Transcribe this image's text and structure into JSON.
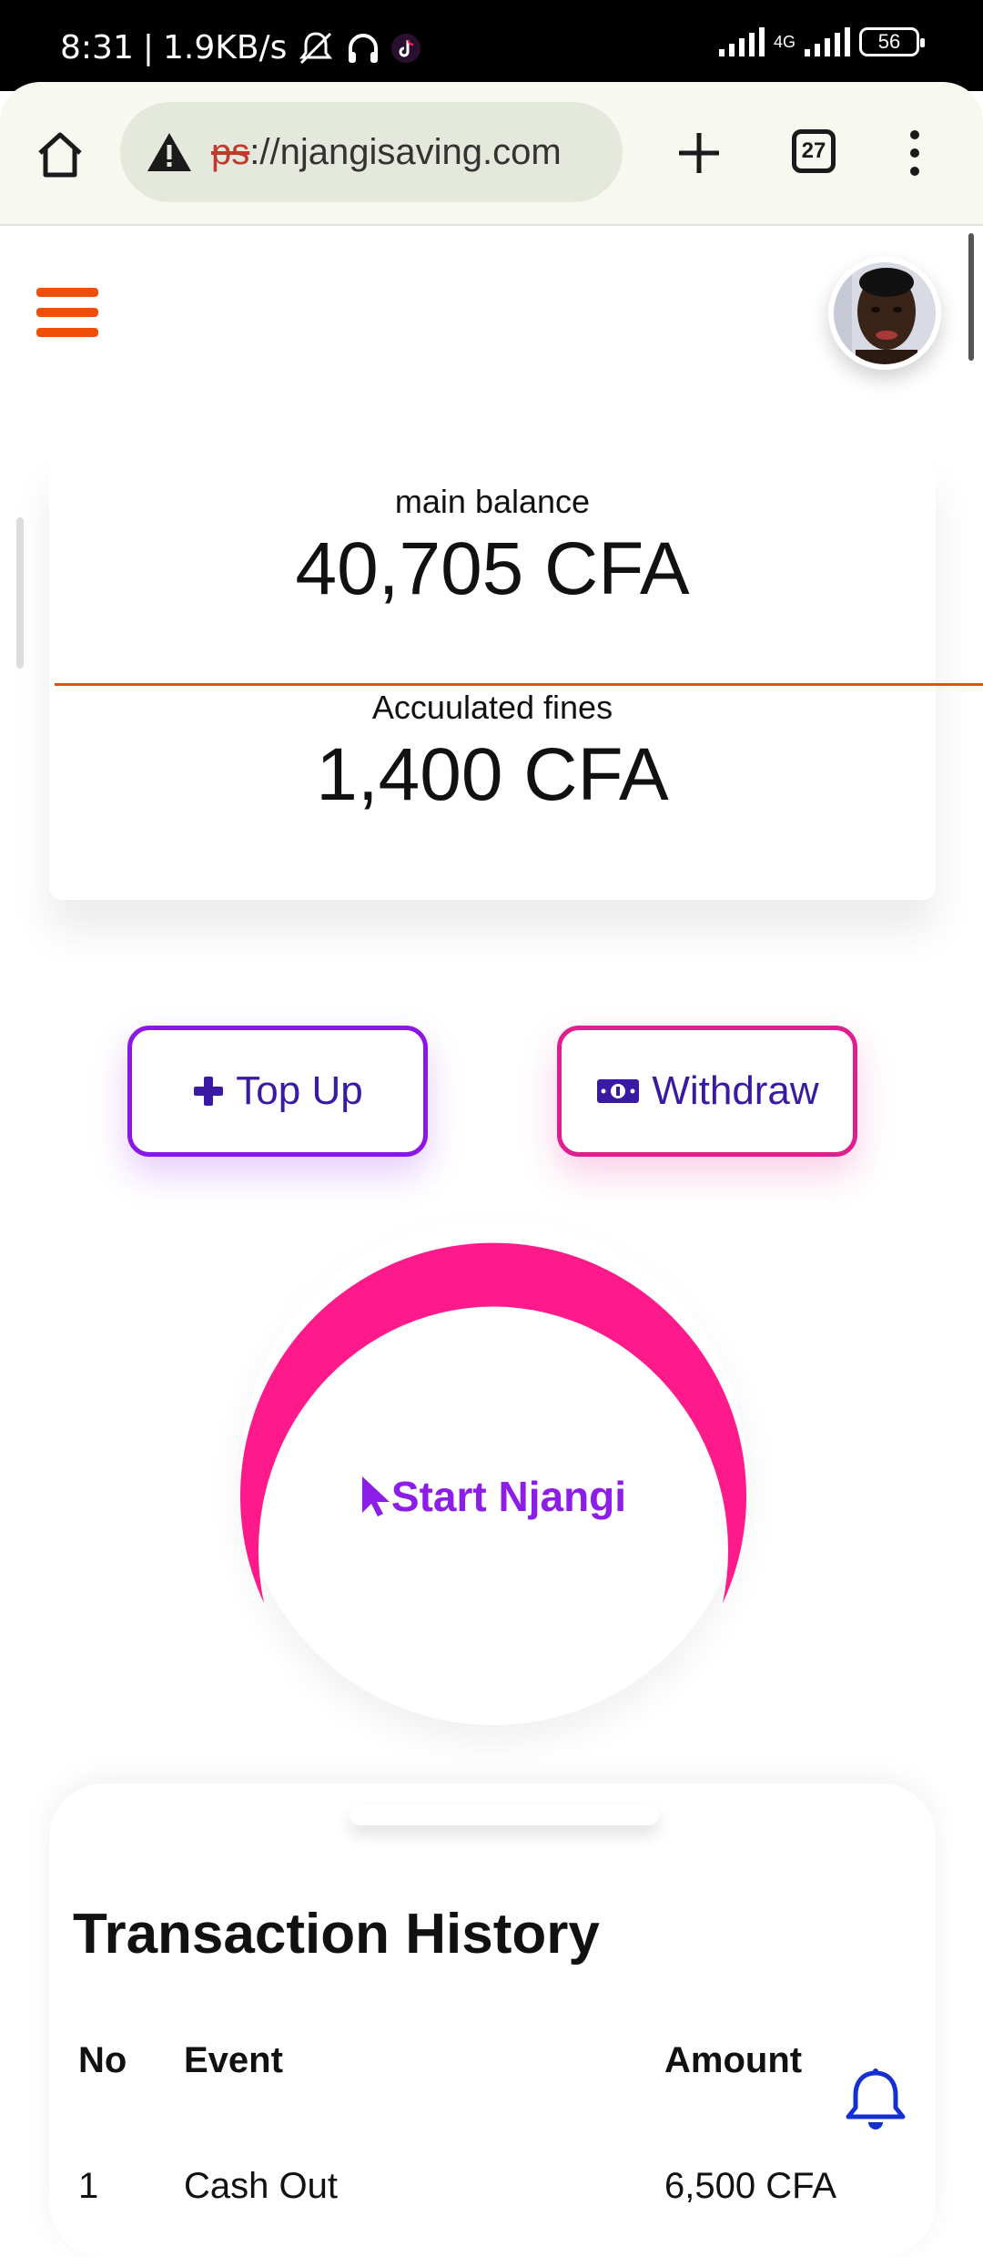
{
  "status_bar": {
    "time": "8:31",
    "network_speed": "1.9KB/s",
    "network_type": "4G",
    "battery": "56"
  },
  "browser": {
    "url_prefix_struck": "ps",
    "url_rest": "://njangisaving.com",
    "tab_count": "27"
  },
  "balance": {
    "main_label": "main balance",
    "main_value": "40,705 CFA",
    "fines_label": "Accuulated fines",
    "fines_value": "1,400 CFA"
  },
  "actions": {
    "top_up_label": "Top Up",
    "withdraw_label": "Withdraw",
    "start_label": "Start Njangi"
  },
  "transaction_history": {
    "title": "Transaction History",
    "columns": [
      "No",
      "Event",
      "Amount"
    ],
    "rows": [
      {
        "no": "1",
        "event": "Cash Out",
        "amount": "6,500 CFA"
      }
    ]
  },
  "colors": {
    "accent_orange": "#f04e09",
    "purple": "#8a17e6",
    "pink": "#e01e8f",
    "link_blue": "#1430d0"
  }
}
